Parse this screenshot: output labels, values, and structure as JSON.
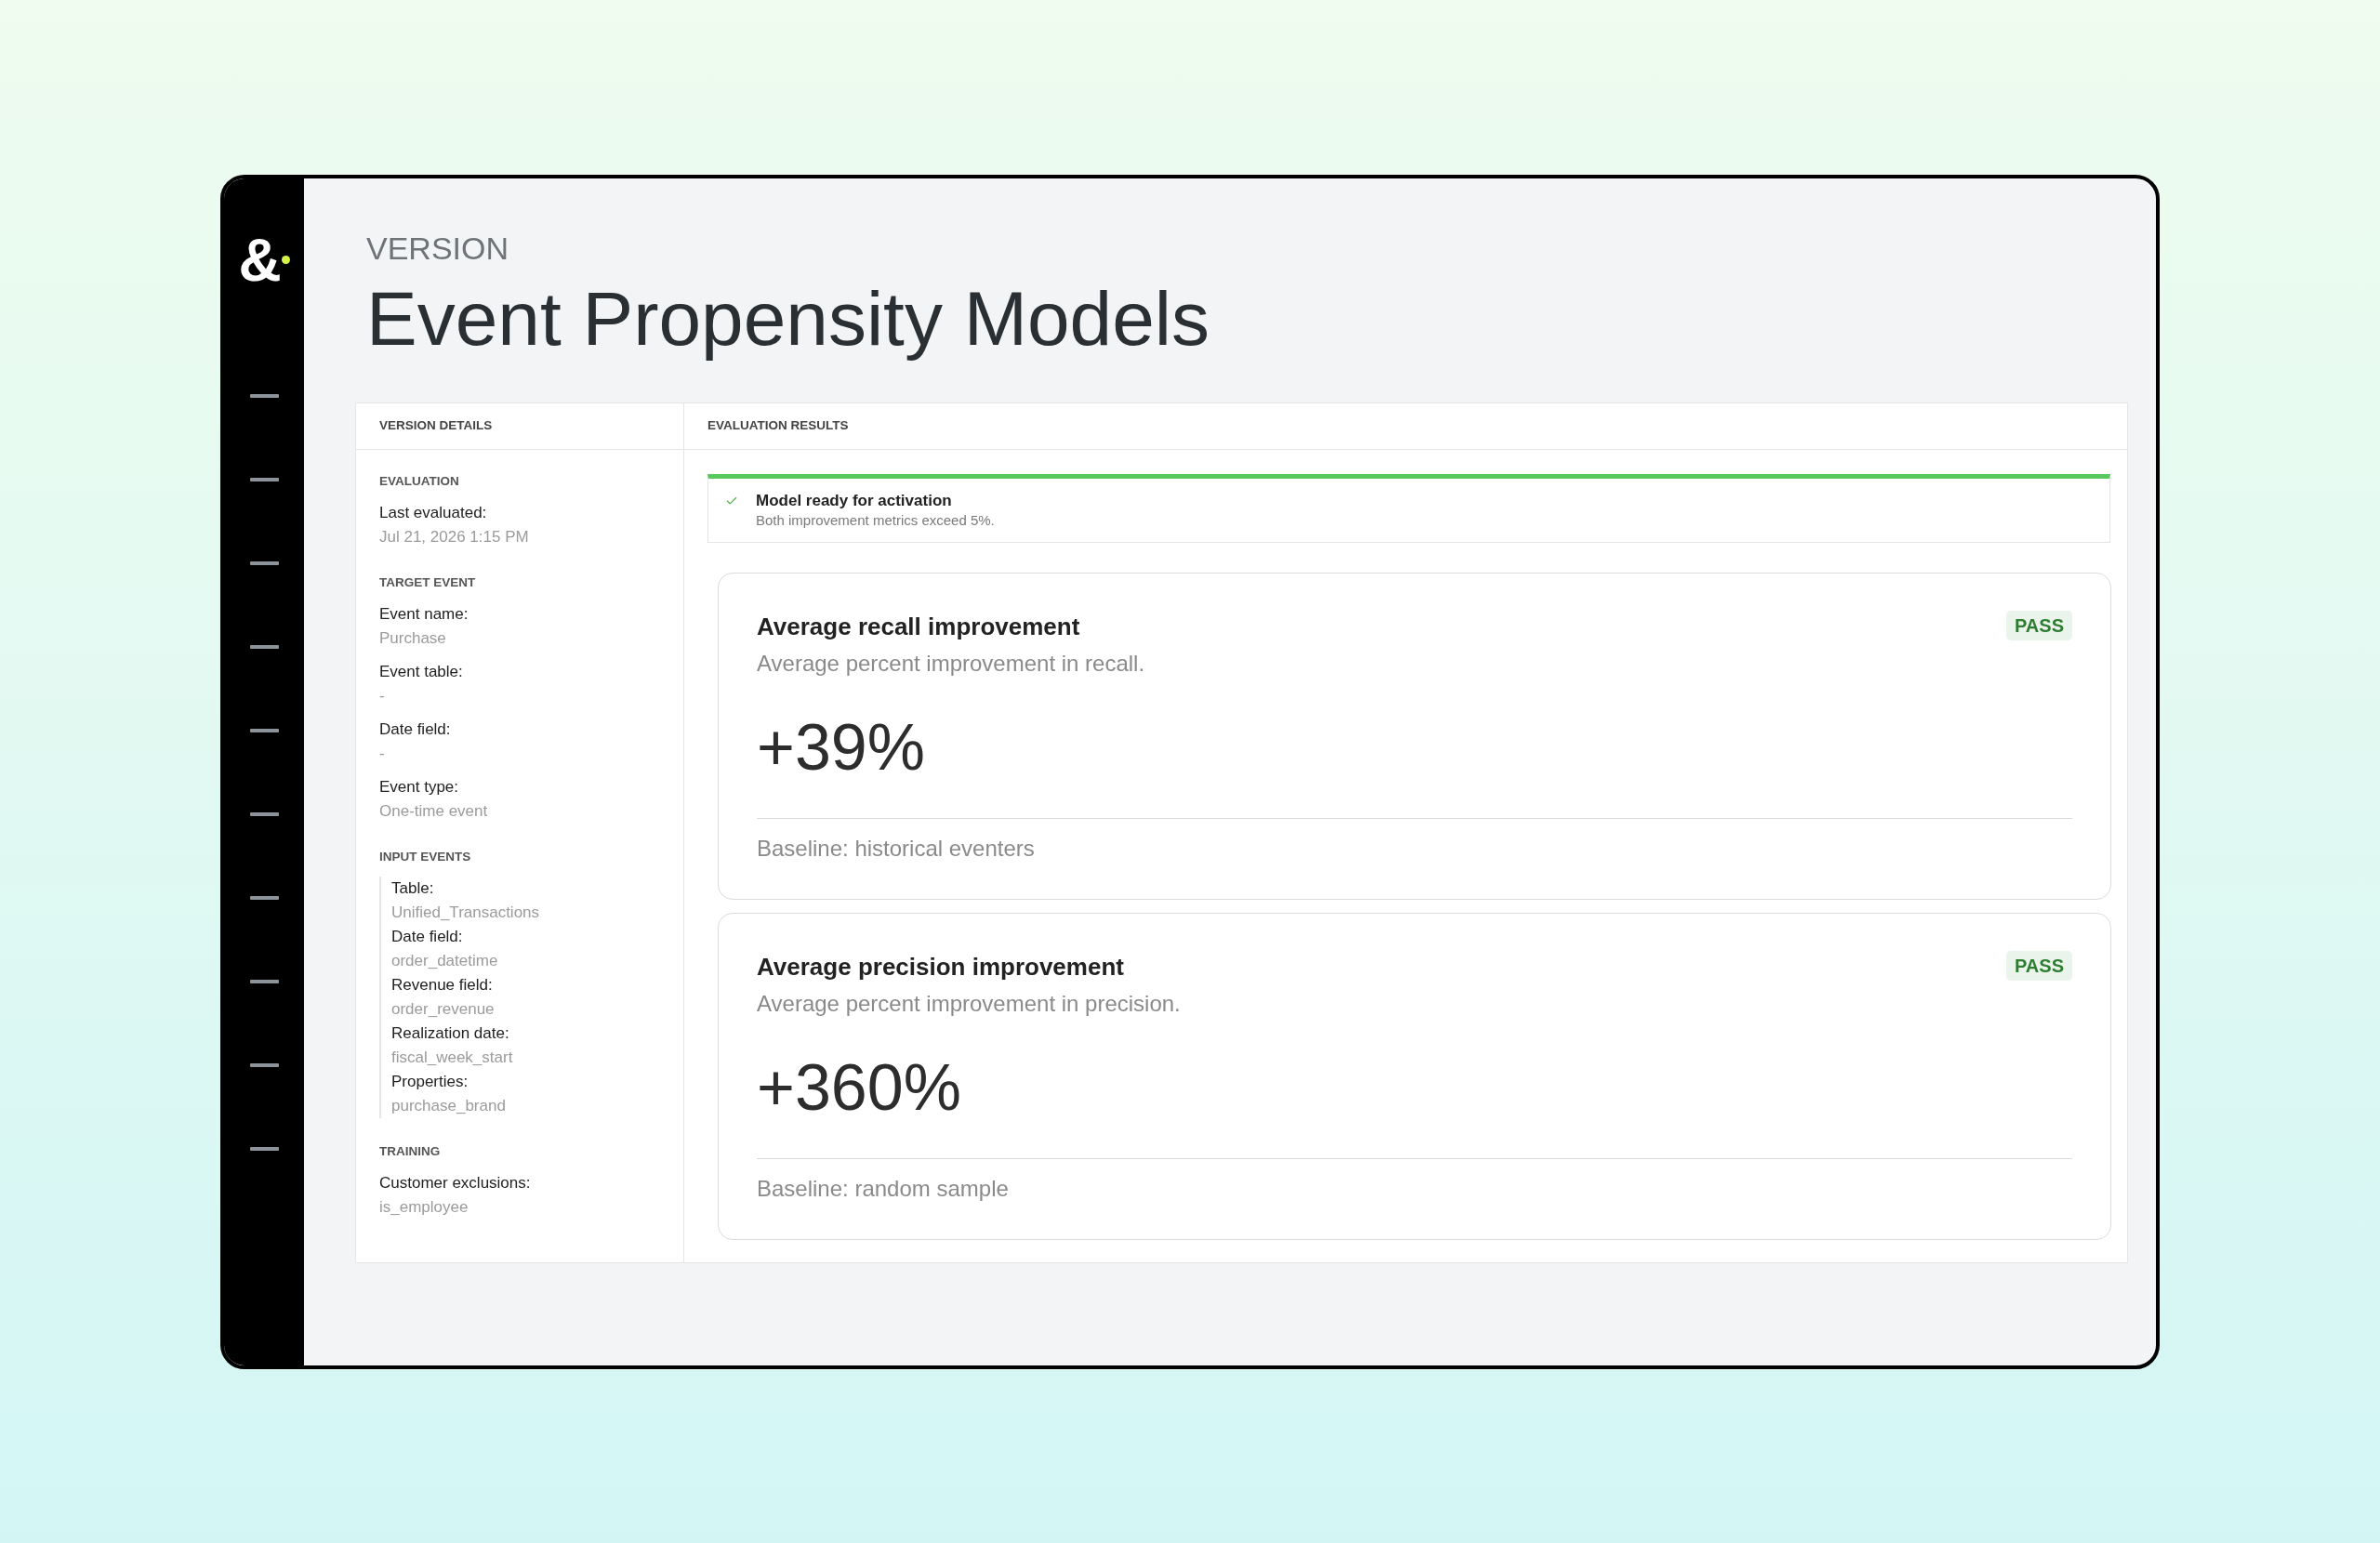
{
  "logo": {
    "mark": "&"
  },
  "header": {
    "eyebrow": "VERSION",
    "title": "Event Propensity Models"
  },
  "version_details": {
    "heading": "VERSION DETAILS",
    "sections": [
      {
        "title": "EVALUATION",
        "kind": "fields",
        "fields": [
          {
            "label": "Last evaluated:",
            "value": "Jul 21, 2026 1:15 PM"
          }
        ]
      },
      {
        "title": "TARGET EVENT",
        "kind": "fields",
        "fields": [
          {
            "label": "Event name:",
            "value": "Purchase"
          },
          {
            "label": "Event table:",
            "value": "-"
          },
          {
            "label": "Date field:",
            "value": "-"
          },
          {
            "label": "Event type:",
            "value": "One-time event"
          }
        ]
      },
      {
        "title": "INPUT EVENTS",
        "kind": "grouped",
        "fields": [
          {
            "label": "Table:",
            "value": "Unified_Transactions"
          },
          {
            "label": "Date field:",
            "value": "order_datetime"
          },
          {
            "label": "Revenue field:",
            "value": "order_revenue"
          },
          {
            "label": "Realization date:",
            "value": "fiscal_week_start"
          },
          {
            "label": "Properties:",
            "value": "purchase_brand"
          }
        ]
      },
      {
        "title": "TRAINING",
        "kind": "fields",
        "fields": [
          {
            "label": "Customer exclusions:",
            "value": "is_employee"
          }
        ]
      }
    ]
  },
  "evaluation_results": {
    "heading": "EVALUATION RESULTS",
    "banner": {
      "title": "Model ready for activation",
      "message": "Both improvement metrics exceed 5%."
    },
    "metrics": [
      {
        "title": "Average recall improvement",
        "description": "Average percent improvement in recall.",
        "badge": "PASS",
        "value": "+39%",
        "baseline": "Baseline: historical eventers"
      },
      {
        "title": "Average precision improvement",
        "description": "Average percent improvement in precision.",
        "badge": "PASS",
        "value": "+360%",
        "baseline": "Baseline: random sample"
      }
    ]
  }
}
